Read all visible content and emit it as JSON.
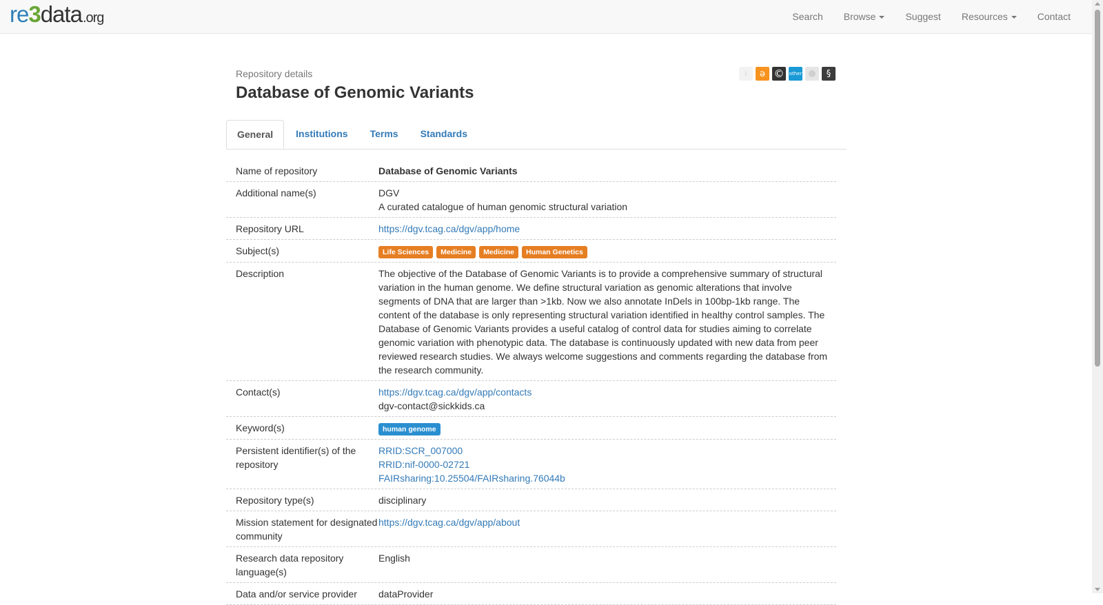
{
  "navbar": {
    "logo": {
      "re": "re",
      "three": "3",
      "data": "data",
      "org": ".org"
    },
    "items": [
      {
        "label": "Search",
        "dropdown": false
      },
      {
        "label": "Browse",
        "dropdown": true
      },
      {
        "label": "Suggest",
        "dropdown": false
      },
      {
        "label": "Resources",
        "dropdown": true
      },
      {
        "label": "Contact",
        "dropdown": false
      }
    ]
  },
  "header": {
    "subtitle": "Repository details",
    "title": "Database of Genomic Variants"
  },
  "icons": {
    "info": "i",
    "open_access": "ə",
    "copyright": "©",
    "other": "other",
    "policy": "§",
    "colors": {
      "open_access": "#f7931e",
      "other": "#1a9ad6",
      "copyright": "#333333"
    }
  },
  "tabs": [
    {
      "label": "General",
      "active": true
    },
    {
      "label": "Institutions",
      "active": false
    },
    {
      "label": "Terms",
      "active": false
    },
    {
      "label": "Standards",
      "active": false
    }
  ],
  "details": {
    "name": {
      "label": "Name of repository",
      "value": "Database of Genomic Variants"
    },
    "additional_names": {
      "label": "Additional name(s)",
      "values": [
        "DGV",
        "A curated catalogue of human genomic structural variation"
      ]
    },
    "url": {
      "label": "Repository URL",
      "value": "https://dgv.tcag.ca/dgv/app/home"
    },
    "subjects": {
      "label": "Subject(s)",
      "values": [
        "Life Sciences",
        "Medicine",
        "Medicine",
        "Human Genetics"
      ],
      "color": "#e67e22"
    },
    "description": {
      "label": "Description",
      "value": "The objective of the Database of Genomic Variants is to provide a comprehensive summary of structural variation in the human genome. We define structural variation as genomic alterations that involve segments of DNA that are larger than >1kb. Now we also annotate InDels in 100bp-1kb range. The content of the database is only representing structural variation identified in healthy control samples. The Database of Genomic Variants provides a useful catalog of control data for studies aiming to correlate genomic variation with phenotypic data. The database is continuously updated with new data from peer reviewed research studies. We always welcome suggestions and comments regarding the database from the research community."
    },
    "contacts": {
      "label": "Contact(s)",
      "link": "https://dgv.tcag.ca/dgv/app/contacts",
      "email": "dgv-contact@sickkids.ca"
    },
    "keywords": {
      "label": "Keyword(s)",
      "values": [
        "human genome"
      ],
      "color": "#2a8fd0"
    },
    "pids": {
      "label": "Persistent identifier(s) of the repository",
      "values": [
        "RRID:SCR_007000",
        "RRID:nif-0000-02721",
        "FAIRsharing:10.25504/FAIRsharing.76044b"
      ]
    },
    "repo_type": {
      "label": "Repository type(s)",
      "value": "disciplinary"
    },
    "mission": {
      "label": "Mission statement for designated community",
      "value": "https://dgv.tcag.ca/dgv/app/about"
    },
    "language": {
      "label": "Research data repository language(s)",
      "value": "English"
    },
    "provider": {
      "label": "Data and/or service provider",
      "value": "dataProvider"
    }
  }
}
